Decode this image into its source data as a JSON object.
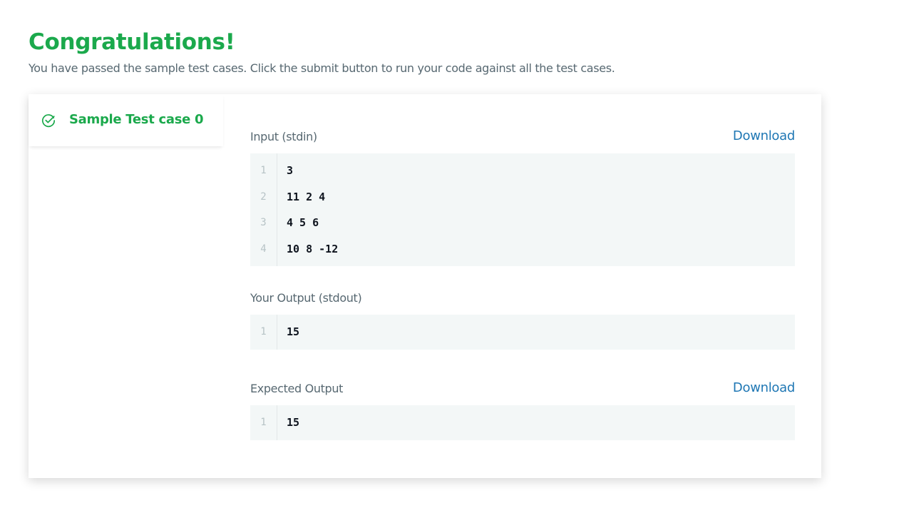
{
  "header": {
    "title": "Congratulations!",
    "subtitle": "You have passed the sample test cases. Click the submit button to run your code against all the test cases."
  },
  "sidebar": {
    "tab_label": "Sample Test case 0",
    "tab_icon": "check-circle-icon",
    "accent_color": "#1ba94c"
  },
  "sections": {
    "input": {
      "label": "Input (stdin)",
      "download_label": "Download",
      "lines": [
        {
          "num": "1",
          "text": "3"
        },
        {
          "num": "2",
          "text": "11 2 4"
        },
        {
          "num": "3",
          "text": "4 5 6"
        },
        {
          "num": "4",
          "text": "10 8 -12"
        }
      ]
    },
    "your_output": {
      "label": "Your Output (stdout)",
      "lines": [
        {
          "num": "1",
          "text": "15"
        }
      ]
    },
    "expected_output": {
      "label": "Expected Output",
      "download_label": "Download",
      "lines": [
        {
          "num": "1",
          "text": "15"
        }
      ]
    }
  },
  "colors": {
    "success": "#1ba94c",
    "link": "#1f77b4",
    "code_bg": "#f3f7f7"
  }
}
